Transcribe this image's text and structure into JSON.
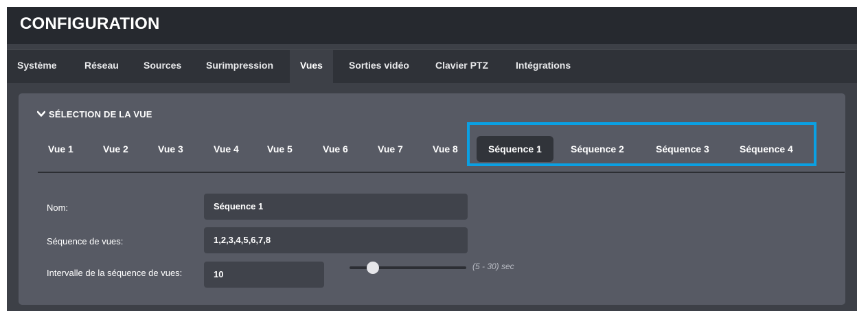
{
  "header": {
    "title": "CONFIGURATION"
  },
  "top_tabs": [
    {
      "label": "Système"
    },
    {
      "label": "Réseau"
    },
    {
      "label": "Sources"
    },
    {
      "label": "Surimpression"
    },
    {
      "label": "Vues",
      "active": true
    },
    {
      "label": "Sorties vidéo"
    },
    {
      "label": "Clavier PTZ"
    },
    {
      "label": "Intégrations"
    }
  ],
  "section": {
    "title": "SÉLECTION DE LA VUE",
    "chevron_icon": "chevron-down-icon",
    "view_tabs": [
      {
        "label": "Vue 1"
      },
      {
        "label": "Vue 2"
      },
      {
        "label": "Vue 3"
      },
      {
        "label": "Vue 4"
      },
      {
        "label": "Vue 5"
      },
      {
        "label": "Vue 6"
      },
      {
        "label": "Vue 7"
      },
      {
        "label": "Vue 8"
      },
      {
        "label": "Séquence 1",
        "active": true
      },
      {
        "label": "Séquence 2"
      },
      {
        "label": "Séquence 3"
      },
      {
        "label": "Séquence 4"
      }
    ]
  },
  "form": {
    "name_label": "Nom:",
    "name_value": "Séquence 1",
    "sequence_label": "Séquence de vues:",
    "sequence_value": "1,2,3,4,5,6,7,8",
    "interval_label": "Intervalle de la séquence de vues:",
    "interval_value": "10",
    "interval_min": 5,
    "interval_max": 30,
    "interval_range_text": "(5 - 30) sec"
  },
  "colors": {
    "highlight": "#0aa0e3",
    "title_bar": "#26292f",
    "tab_bar": "#2f3238",
    "panel": "#575a64"
  }
}
